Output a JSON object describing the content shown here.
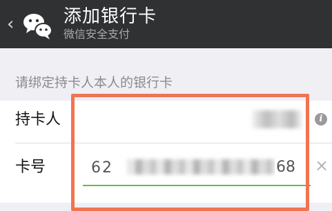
{
  "header": {
    "title": "添加银行卡",
    "subtitle": "微信安全支付",
    "back_icon": "chevron-left-icon",
    "logo_icon": "wechat-icon"
  },
  "form": {
    "hint": "请绑定持卡人本人的银行卡",
    "holder": {
      "label": "持卡人",
      "info_icon": "info-icon"
    },
    "card": {
      "label": "卡号",
      "value_prefix": "62",
      "value_suffix": "68",
      "clear_icon": "clear-icon"
    }
  },
  "colors": {
    "header_bg": "#2f3133",
    "page_bg": "#efeff4",
    "accent_green": "#62b946",
    "highlight_red": "#f07452"
  }
}
